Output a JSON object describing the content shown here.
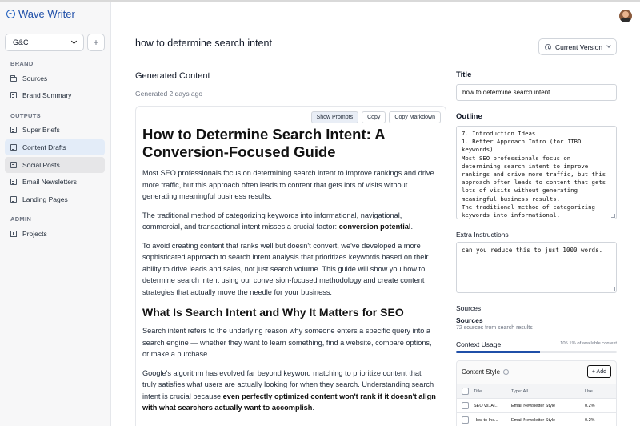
{
  "app": {
    "name": "Wave Writer"
  },
  "sidebar": {
    "workspace": "G&C",
    "add_label": "+",
    "sections": [
      {
        "label": "BRAND",
        "items": [
          {
            "label": "Sources",
            "icon": "folder-icon"
          },
          {
            "label": "Brand Summary",
            "icon": "document-icon"
          }
        ]
      },
      {
        "label": "OUTPUTS",
        "items": [
          {
            "label": "Super Briefs",
            "icon": "document-icon"
          },
          {
            "label": "Content Drafts",
            "icon": "document-icon",
            "state": "active"
          },
          {
            "label": "Social Posts",
            "icon": "document-icon",
            "state": "hover"
          },
          {
            "label": "Email Newsletters",
            "icon": "document-icon"
          },
          {
            "label": "Landing Pages",
            "icon": "document-icon"
          }
        ]
      },
      {
        "label": "ADMIN",
        "items": [
          {
            "label": "Projects",
            "icon": "grid-icon"
          }
        ]
      }
    ]
  },
  "page": {
    "title": "how to determine search intent",
    "version_select": "Current Version"
  },
  "generated": {
    "heading": "Generated Content",
    "subtitle": "Generated 2 days ago",
    "buttons": {
      "show_prompts": "Show Prompts",
      "copy": "Copy",
      "copy_markdown": "Copy Markdown"
    },
    "article": {
      "h1": "How to Determine Search Intent: A Conversion-Focused Guide",
      "p1": "Most SEO professionals focus on determining search intent to improve rankings and drive more traffic, but this approach often leads to content that gets lots of visits without generating meaningful business results.",
      "p2_text": "The traditional method of categorizing keywords into informational, navigational, commercial, and transactional intent misses a crucial factor: ",
      "p2_bold": "conversion potential",
      "p2_end": ".",
      "p3": "To avoid creating content that ranks well but doesn't convert, we've developed a more sophisticated approach to search intent analysis that prioritizes keywords based on their ability to drive leads and sales, not just search volume. This guide will show you how to determine search intent using our conversion-focused methodology and create content strategies that actually move the needle for your business.",
      "h2": "What Is Search Intent and Why It Matters for SEO",
      "p4": "Search intent refers to the underlying reason why someone enters a specific query into a search engine — whether they want to learn something, find a website, compare options, or make a purchase.",
      "p5_text": "Google's algorithm has evolved far beyond keyword matching to prioritize content that truly satisfies what users are actually looking for when they search. Understanding search intent is crucial because ",
      "p5_bold": "even perfectly optimized content won't rank if it doesn't align with what searchers actually want to accomplish",
      "p5_end": "."
    }
  },
  "panel": {
    "title_label": "Title",
    "title_value": "how to determine search intent",
    "outline_label": "Outline",
    "outline_value": "7. Introduction Ideas\n1. Better Approach Intro (for JTBD keywords)\nMost SEO professionals focus on determining search intent to improve rankings and drive more traffic, but this approach often leads to content that gets lots of visits without generating meaningful business results.\nThe traditional method of categorizing keywords into informational,",
    "extra_label": "Extra Instructions",
    "extra_value": "can you reduce this to just 1000 words.",
    "sources_label": "Sources",
    "sources_title": "Sources",
    "sources_sub": "72 sources from search results",
    "usage_label": "Context Usage",
    "usage_pct_text": "105.1% of available context",
    "usage_fill": 0.52,
    "style_label": "Content Style",
    "style_add": "+ Add",
    "style_table": {
      "headers": {
        "title": "Title",
        "type": "Type: All",
        "use": "Use"
      },
      "rows": [
        {
          "title": "SEO vs. AI...",
          "type": "Email Newsletter Style",
          "use": "0.2%"
        },
        {
          "title": "How to Inc...",
          "type": "Email Newsletter Style",
          "use": "0.2%"
        }
      ]
    }
  },
  "colors": {
    "brand": "#1f4fa8",
    "active_nav": "#e3ecf8",
    "usage_bar": "#1f4fa8"
  }
}
